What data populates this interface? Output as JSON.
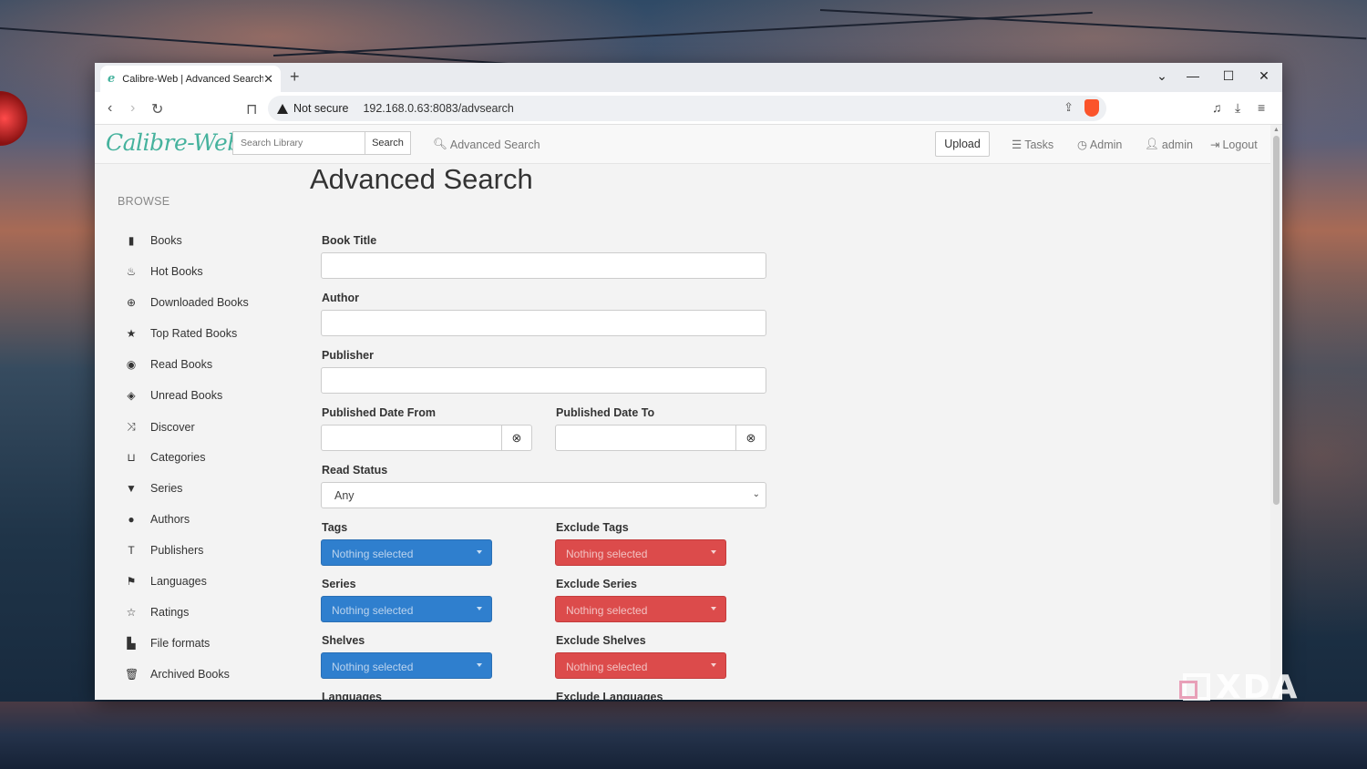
{
  "browser": {
    "tab_title": "Calibre-Web | Advanced Search",
    "tab_favicon": "e",
    "new_tab": "+",
    "security_label": "Not secure",
    "url": "192.168.0.63:8083/advsearch"
  },
  "navbar": {
    "brand": "Calibre-Web",
    "search_placeholder": "Search Library",
    "search_button": "Search",
    "advanced_search": "Advanced Search",
    "upload": "Upload",
    "tasks": "Tasks",
    "admin": "Admin",
    "user": "admin",
    "logout": "Logout"
  },
  "sidebar": {
    "heading": "BROWSE",
    "items": [
      {
        "label": "Books",
        "icon": "book-icon"
      },
      {
        "label": "Hot Books",
        "icon": "fire-icon"
      },
      {
        "label": "Downloaded Books",
        "icon": "download-icon"
      },
      {
        "label": "Top Rated Books",
        "icon": "star-icon"
      },
      {
        "label": "Read Books",
        "icon": "eye-icon"
      },
      {
        "label": "Unread Books",
        "icon": "eye-slash-icon"
      },
      {
        "label": "Discover",
        "icon": "random-icon"
      },
      {
        "label": "Categories",
        "icon": "inbox-icon"
      },
      {
        "label": "Series",
        "icon": "bookmark-icon"
      },
      {
        "label": "Authors",
        "icon": "user-icon"
      },
      {
        "label": "Publishers",
        "icon": "text-size-icon"
      },
      {
        "label": "Languages",
        "icon": "flag-icon"
      },
      {
        "label": "Ratings",
        "icon": "star-empty-icon"
      },
      {
        "label": "File formats",
        "icon": "file-icon"
      },
      {
        "label": "Archived Books",
        "icon": "trash-icon"
      }
    ]
  },
  "form": {
    "title": "Advanced Search",
    "book_title_label": "Book Title",
    "author_label": "Author",
    "publisher_label": "Publisher",
    "date_from_label": "Published Date From",
    "date_to_label": "Published Date To",
    "read_status_label": "Read Status",
    "read_status_value": "Any",
    "tags_label": "Tags",
    "exclude_tags_label": "Exclude Tags",
    "series_label": "Series",
    "exclude_series_label": "Exclude Series",
    "shelves_label": "Shelves",
    "exclude_shelves_label": "Exclude Shelves",
    "languages_label": "Languages",
    "exclude_languages_label": "Exclude Languages",
    "nothing_selected": "Nothing selected"
  },
  "colors": {
    "brand": "#45b29d",
    "include_select": "#2f7fce",
    "exclude_select": "#dc4b4b"
  },
  "watermark": "XDA"
}
